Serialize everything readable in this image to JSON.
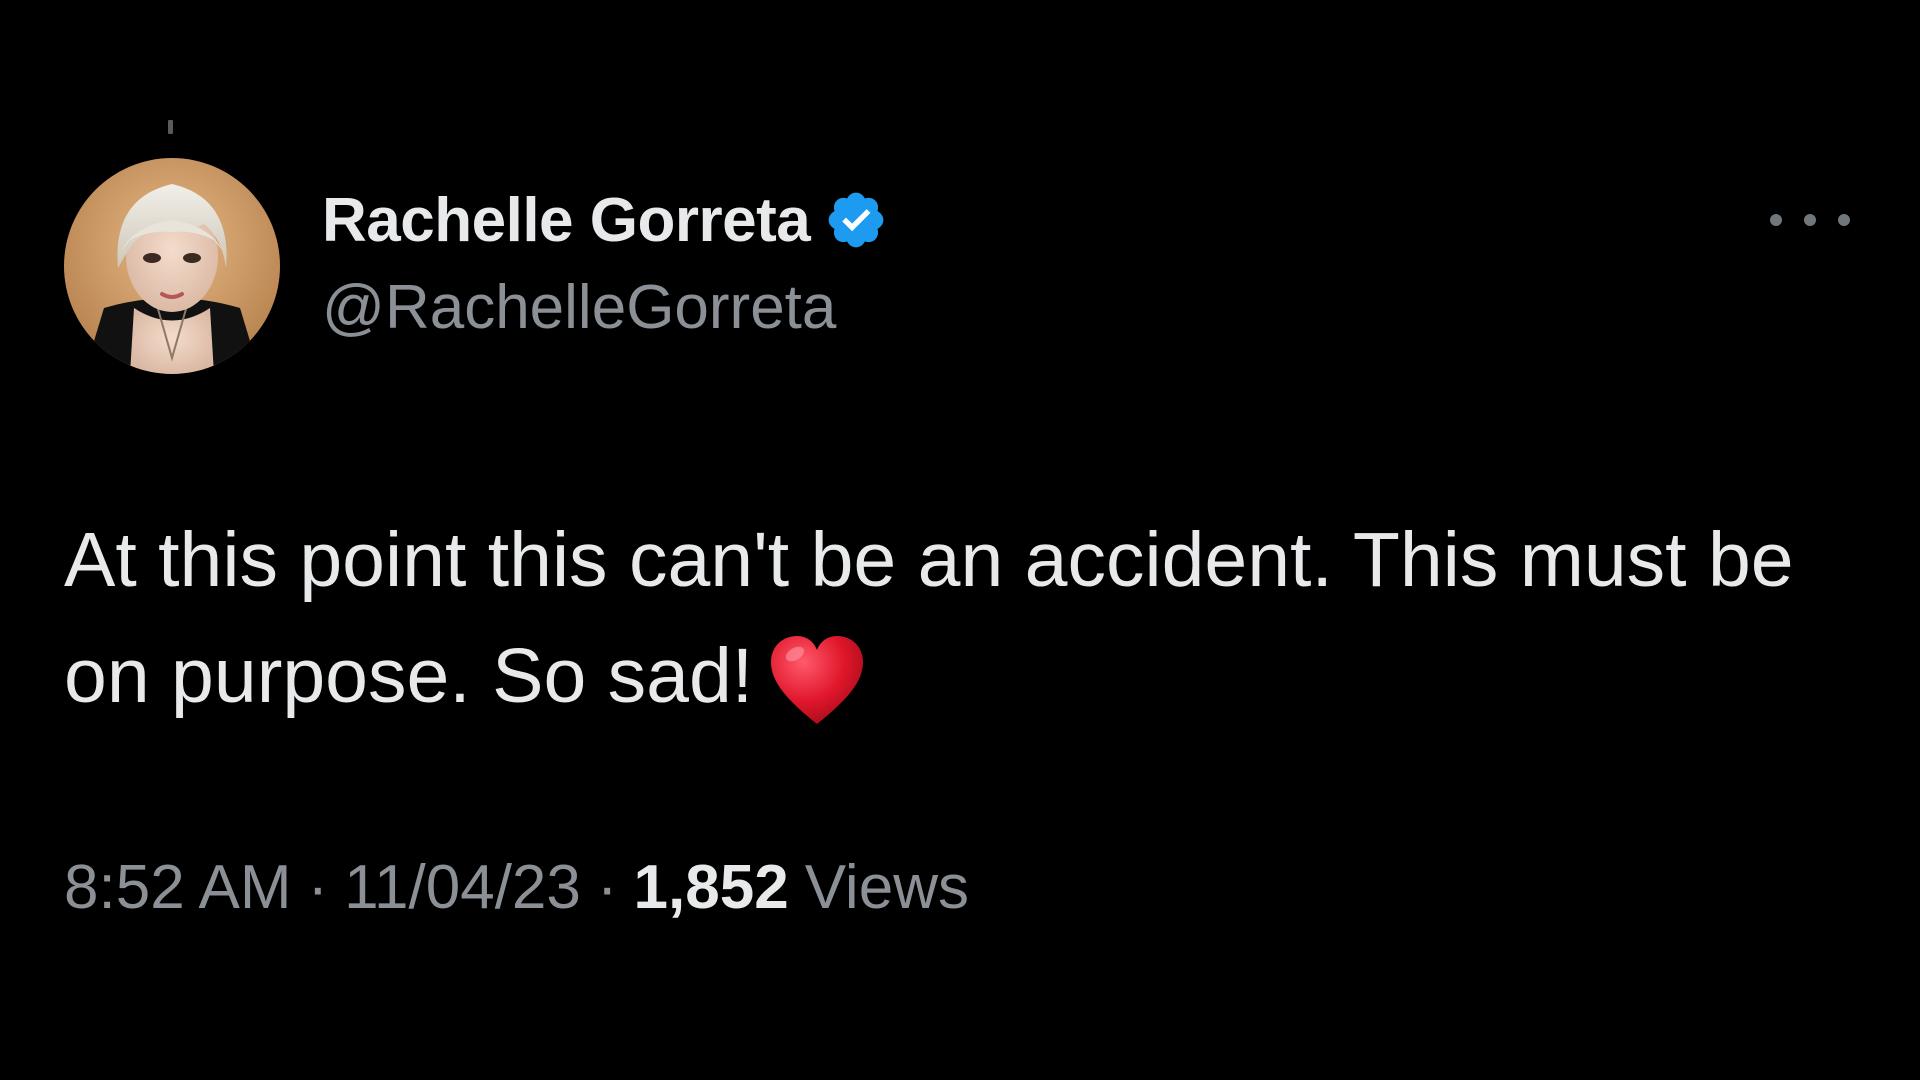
{
  "tweet": {
    "author": {
      "display_name": "Rachelle Gorreta",
      "handle": "@RachelleGorreta",
      "verified": true,
      "verified_color": "#1d9bf0",
      "avatar_icon": "profile-photo"
    },
    "more_icon": "more-horizontal-icon",
    "text": "At this point this can't be an accident. This must be on purpose. So sad!",
    "emoji": "heart-emoji",
    "meta": {
      "time": "8:52 AM",
      "separator": "·",
      "date": "11/04/23",
      "views_count": "1,852",
      "views_label": "Views"
    }
  },
  "colors": {
    "background": "#000000",
    "primary_text": "#e7e9ea",
    "secondary_text": "#8b9096",
    "heart": "#e0162b"
  }
}
